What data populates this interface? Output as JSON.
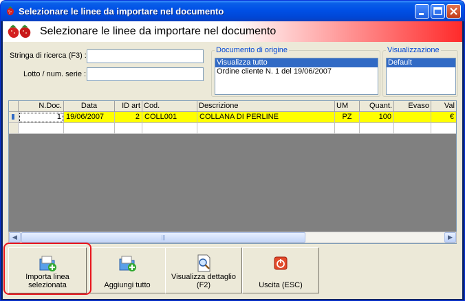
{
  "window": {
    "title": "Selezionare le linee da importare nel documento"
  },
  "banner": {
    "text": "Selezionare le linee da importare nel documento",
    "icon": "strawberries-icon"
  },
  "search": {
    "label": "Stringa di ricerca (F3) :",
    "value": ""
  },
  "lot": {
    "label": "Lotto / num. serie :",
    "value": ""
  },
  "origin": {
    "title": "Documento di origine",
    "items": [
      "Visualizza tutto",
      "Ordine cliente N. 1 del 19/06/2007"
    ],
    "selected": 0
  },
  "view": {
    "title": "Visualizzazione",
    "items": [
      "Default"
    ],
    "selected": 0
  },
  "grid": {
    "columns": [
      "N.Doc.",
      "Data",
      "ID art",
      "Cod.",
      "Descrizione",
      "UM",
      "Quant.",
      "Evaso",
      "Val"
    ],
    "rows": [
      [
        "1",
        "19/06/2007",
        "2",
        "COLL001",
        "COLLANA DI PERLINE",
        "PZ",
        "100",
        "",
        "€"
      ]
    ],
    "scroll_grip": "|||"
  },
  "buttons": {
    "import_line": "Importa linea selezionata",
    "add_all": "Aggiungi tutto",
    "view_detail": "Visualizza dettaglio (F2)",
    "exit": "Uscita (ESC)"
  },
  "colors": {
    "title_bar": "#0050e6",
    "selected_row": "#ffff00",
    "selection": "#316ac5",
    "highlight": "#e8141c"
  }
}
